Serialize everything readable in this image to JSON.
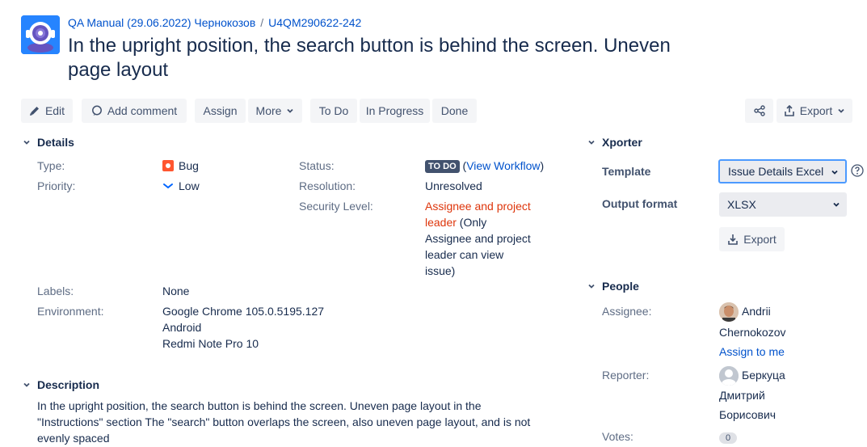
{
  "breadcrumb": {
    "project": "QA Manual (29.06.2022) Чернокозов",
    "separator": "/",
    "issue_key": "U4QM290622-242"
  },
  "issue": {
    "title": "In the upright position, the search button is behind the screen. Uneven page layout"
  },
  "toolbar": {
    "edit": "Edit",
    "add_comment": "Add comment",
    "assign": "Assign",
    "more": "More",
    "todo": "To Do",
    "in_progress": "In Progress",
    "done": "Done",
    "export": "Export"
  },
  "details": {
    "heading": "Details",
    "type_label": "Type:",
    "type_value": "Bug",
    "priority_label": "Priority:",
    "priority_value": "Low",
    "status_label": "Status:",
    "status_value": "TO DO",
    "view_workflow": "View Workflow",
    "resolution_label": "Resolution:",
    "resolution_value": "Unresolved",
    "security_label": "Security Level:",
    "security_line1": "Assignee and project",
    "security_line2": "leader",
    "security_line2b": " (Only",
    "security_line3": "Assignee and project",
    "security_line4": "leader can view",
    "security_line5": "issue)",
    "labels_label": "Labels:",
    "labels_value": "None",
    "environment_label": "Environment:",
    "environment_line1": "Google Chrome 105.0.5195.127",
    "environment_line2": "Android",
    "environment_line3": "Redmi Note Pro 10"
  },
  "description": {
    "heading": "Description",
    "line1": "In the upright position, the search button is behind the screen. Uneven page layout in the",
    "line2": "\"Instructions\" section The \"search\" button overlaps the screen, also uneven page layout, and is not",
    "line3": "evenly spaced"
  },
  "xporter": {
    "heading": "Xporter",
    "template_label": "Template",
    "template_value": "Issue Details Excel",
    "output_label": "Output format",
    "output_value": "XLSX",
    "export_button": "Export"
  },
  "people": {
    "heading": "People",
    "assignee_label": "Assignee:",
    "assignee_first": "Andrii",
    "assignee_last": "Chernokozov",
    "assign_to_me": "Assign to me",
    "reporter_label": "Reporter:",
    "reporter_line1": "Беркуца",
    "reporter_line2": "Дмитрий",
    "reporter_line3": "Борисович",
    "votes_label": "Votes:",
    "votes_value": "0"
  },
  "colors": {
    "link": "#0052cc",
    "danger": "#de350b",
    "button_bg": "#f4f5f7",
    "lozenge": "#42526e",
    "focus": "#4c9aff"
  }
}
